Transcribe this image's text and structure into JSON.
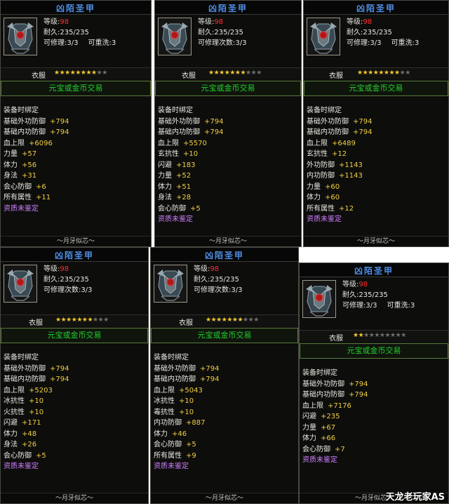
{
  "watermark": "天龙老玩家AS",
  "panels": [
    {
      "title": "凶陌圣甲",
      "level_label": "等级:",
      "level": "98",
      "rows": [
        [
          "耐久:235/235"
        ],
        [
          "可修理:3/3",
          "可重洗:3"
        ]
      ],
      "slot": "衣服",
      "stars_on": 8,
      "stars_total": 10,
      "trade": "元宝或金币交易",
      "bind": "装备时绑定",
      "stats": [
        [
          "基础外功防御",
          "+794"
        ],
        [
          "基础内功防御",
          "+794"
        ],
        [
          "血上限",
          "+6096"
        ],
        [
          "力量",
          "+57"
        ],
        [
          "体力",
          "+56"
        ],
        [
          "身法",
          "+31"
        ],
        [
          "会心防御",
          "+6"
        ],
        [
          "所有属性",
          "+11"
        ]
      ],
      "note": "资质未鉴定",
      "footer": "〜月牙似芯〜"
    },
    {
      "title": "凶陌圣甲",
      "level_label": "等级:",
      "level": "98",
      "rows": [
        [
          "耐久:235/235"
        ],
        [
          "可修理次数:3/3"
        ]
      ],
      "slot": "衣服",
      "stars_on": 7,
      "stars_total": 10,
      "trade": "元宝或金币交易",
      "bind": "装备时绑定",
      "stats": [
        [
          "基础外功防御",
          "+794"
        ],
        [
          "基础内功防御",
          "+794"
        ],
        [
          "血上限",
          "+5570"
        ],
        [
          "玄抗性",
          "+10"
        ],
        [
          "闪避",
          "+183"
        ],
        [
          "力量",
          "+52"
        ],
        [
          "体力",
          "+51"
        ],
        [
          "身法",
          "+28"
        ],
        [
          "会心防御",
          "+5"
        ]
      ],
      "note": "资质未鉴定",
      "footer": "〜月牙似芯〜"
    },
    {
      "title": "凶陌圣甲",
      "level_label": "等级:",
      "level": "98",
      "rows": [
        [
          "耐久:235/235"
        ],
        [
          "可修理:3/3",
          "可重洗:3"
        ]
      ],
      "slot": "衣服",
      "stars_on": 8,
      "stars_total": 10,
      "trade": "元宝或金币交易",
      "bind": "装备时绑定",
      "stats": [
        [
          "基础外功防御",
          "+794"
        ],
        [
          "基础内功防御",
          "+794"
        ],
        [
          "血上限",
          "+6489"
        ],
        [
          "玄抗性",
          "+12"
        ],
        [
          "外功防御",
          "+1143"
        ],
        [
          "内功防御",
          "+1143"
        ],
        [
          "力量",
          "+60"
        ],
        [
          "体力",
          "+60"
        ],
        [
          "所有属性",
          "+12"
        ]
      ],
      "note": "资质未鉴定",
      "footer": "〜月牙似芯〜"
    },
    {
      "title": "凶陌圣甲",
      "level_label": "等级:",
      "level": "98",
      "rows": [
        [
          "耐久:235/235"
        ],
        [
          "可修理次数:3/3"
        ]
      ],
      "slot": "衣服",
      "stars_on": 7,
      "stars_total": 10,
      "trade": "元宝或金币交易",
      "bind": "装备时绑定",
      "stats": [
        [
          "基础外功防御",
          "+794"
        ],
        [
          "基础内功防御",
          "+794"
        ],
        [
          "血上限",
          "+5203"
        ],
        [
          "冰抗性",
          "+10"
        ],
        [
          "火抗性",
          "+10"
        ],
        [
          "闪避",
          "+171"
        ],
        [
          "体力",
          "+48"
        ],
        [
          "身法",
          "+26"
        ],
        [
          "会心防御",
          "+5"
        ]
      ],
      "note": "资质未鉴定",
      "footer": "〜月牙似芯〜"
    },
    {
      "title": "凶陌圣甲",
      "level_label": "等级:",
      "level": "98",
      "rows": [
        [
          "耐久:235/235"
        ],
        [
          "可修理次数:3/3"
        ]
      ],
      "slot": "衣服",
      "stars_on": 7,
      "stars_total": 10,
      "trade": "元宝或金币交易",
      "bind": "装备时绑定",
      "stats": [
        [
          "基础外功防御",
          "+794"
        ],
        [
          "基础内功防御",
          "+794"
        ],
        [
          "血上限",
          "+5043"
        ],
        [
          "冰抗性",
          "+10"
        ],
        [
          "毒抗性",
          "+10"
        ],
        [
          "内功防御",
          "+887"
        ],
        [
          "体力",
          "+46"
        ],
        [
          "会心防御",
          "+5"
        ],
        [
          "所有属性",
          "+9"
        ]
      ],
      "note": "资质未鉴定",
      "footer": "〜月牙似芯〜"
    },
    {
      "title": "凶陌圣甲",
      "level_label": "等级:",
      "level": "98",
      "rows": [
        [
          "耐久:235/235"
        ],
        [
          "可修理:3/3",
          "可重洗:3"
        ]
      ],
      "slot": "衣服",
      "stars_on": 2,
      "stars_total": 10,
      "trade": "元宝或金币交易",
      "bind": "装备时绑定",
      "stats": [
        [
          "基础外功防御",
          "+794"
        ],
        [
          "基础内功防御",
          "+794"
        ],
        [
          "血上限",
          "+7176"
        ],
        [
          "闪避",
          "+235"
        ],
        [
          "力量",
          "+67"
        ],
        [
          "体力",
          "+66"
        ],
        [
          "会心防御",
          "+7"
        ]
      ],
      "note": "资质未鉴定",
      "footer": "〜月牙似芯〜"
    }
  ]
}
